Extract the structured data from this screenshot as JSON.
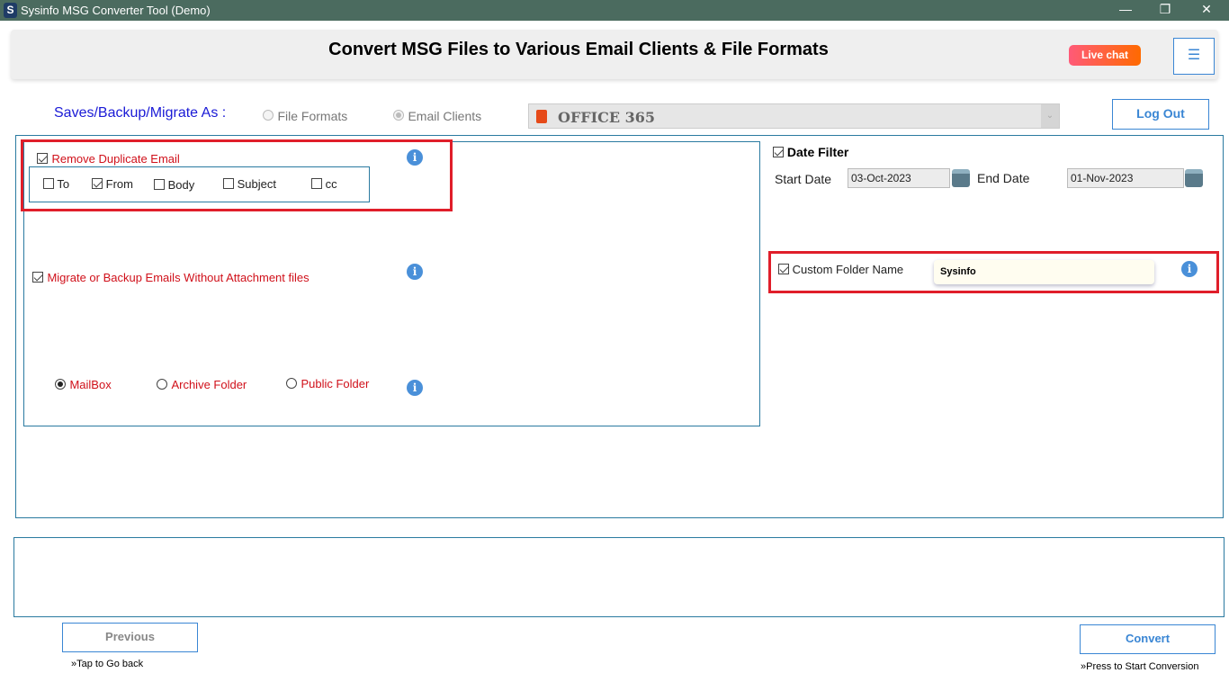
{
  "window": {
    "title": "Sysinfo MSG Converter Tool (Demo)",
    "logo": "S",
    "minimize": "—",
    "restore": "❐",
    "close": "✕"
  },
  "header": {
    "title": "Convert MSG Files to Various Email Clients & File Formats",
    "live_chat": "Live chat",
    "menu_icon": "☰"
  },
  "save_as": {
    "label": "Saves/Backup/Migrate As :",
    "option_file_formats": "File Formats",
    "option_email_clients": "Email Clients",
    "selected": "Email Clients",
    "target": "OFFICE 365",
    "logout": "Log Out"
  },
  "duplicate": {
    "label": "Remove Duplicate Email",
    "checked": true,
    "fields": [
      {
        "label": "To",
        "checked": false
      },
      {
        "label": "From",
        "checked": true
      },
      {
        "label": "Body",
        "checked": false
      },
      {
        "label": "Subject",
        "checked": false
      },
      {
        "label": "cc",
        "checked": false
      }
    ]
  },
  "no_attachment": {
    "label": "Migrate or Backup Emails Without Attachment files",
    "checked": true
  },
  "folder_type": {
    "options": [
      "MailBox",
      "Archive Folder",
      "Public Folder"
    ],
    "selected": "MailBox"
  },
  "date_filter": {
    "label": "Date Filter",
    "checked": true,
    "start_label": "Start Date",
    "start": "03-Oct-2023",
    "end_label": "End Date",
    "end": "01-Nov-2023"
  },
  "custom_folder": {
    "label": "Custom Folder Name",
    "checked": true,
    "value": "Sysinfo"
  },
  "info_icon": "i",
  "footer": {
    "previous": "Previous",
    "previous_hint": "»Tap to Go back",
    "convert": "Convert",
    "convert_hint": "»Press to Start Conversion"
  }
}
